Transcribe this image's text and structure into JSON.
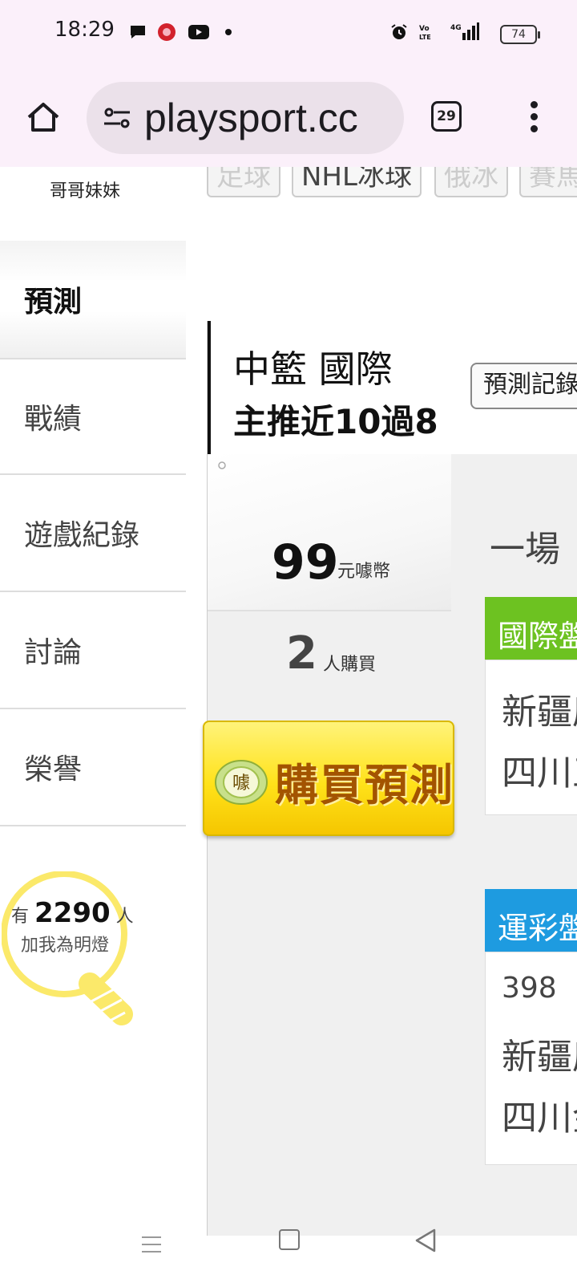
{
  "status_bar": {
    "time": "18:29",
    "network": "4G",
    "battery": "74"
  },
  "browser": {
    "url": "playsport.cc",
    "tab_count": "29"
  },
  "sidebar": {
    "sibling_name": "哥哥妹妹",
    "items": [
      {
        "label": "預測",
        "active": true
      },
      {
        "label": "戰績"
      },
      {
        "label": "遊戲紀錄"
      },
      {
        "label": "討論"
      },
      {
        "label": "榮譽"
      }
    ],
    "lamp": {
      "prefix": "有",
      "count": "2290",
      "suffix": "人",
      "caption": "加我為明燈"
    }
  },
  "sport_tabs": [
    "足球",
    "NHL冰球",
    "俄冰",
    "賽馬"
  ],
  "prediction": {
    "title": "中籃 國際",
    "subtitle": "主推近10過8",
    "record_button": "預測記錄",
    "price": "99",
    "price_unit": "元噱幣",
    "single_game": "一場",
    "buyers": "2",
    "buyers_unit": "人購買",
    "buy_button": "購買預測",
    "coin_char": "噱"
  },
  "markets": {
    "international": {
      "header": "國際盤",
      "team1": "新疆廣",
      "team2": "四川五"
    },
    "sports_lottery": {
      "header": "運彩盤",
      "code": "398",
      "team1": "新疆廣",
      "team2": "四川金"
    }
  },
  "colors": {
    "green_header": "#6dc221",
    "blue_header": "#1e9be0",
    "buy_yellow": "#ffe21a",
    "chrome_bg": "#fbf0fa"
  }
}
